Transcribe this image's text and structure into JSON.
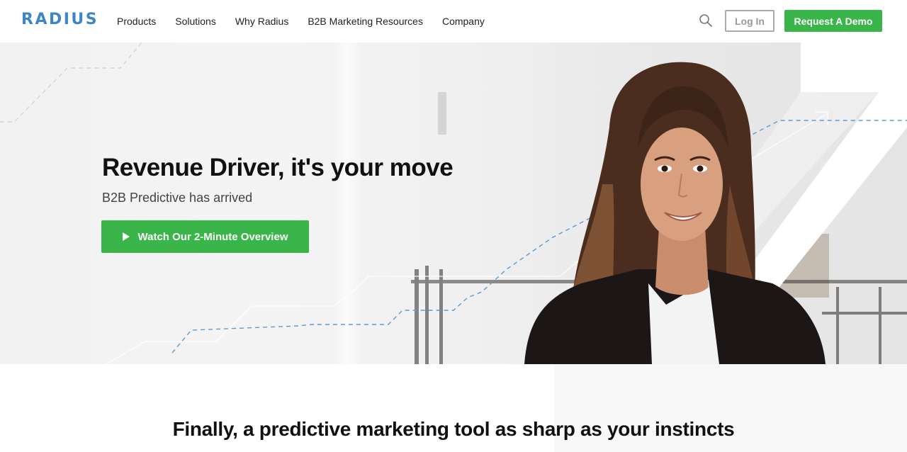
{
  "header": {
    "logo": "RADIUS",
    "nav": [
      {
        "label": "Products"
      },
      {
        "label": "Solutions"
      },
      {
        "label": "Why Radius"
      },
      {
        "label": "B2B Marketing Resources"
      },
      {
        "label": "Company"
      }
    ],
    "search_icon": "search-icon",
    "login_label": "Log In",
    "demo_label": "Request A Demo"
  },
  "hero": {
    "title": "Revenue Driver, it's your move",
    "subtitle": "B2B Predictive has arrived",
    "cta_label": "Watch Our 2-Minute Overview",
    "cta_icon": "play-icon",
    "image_alt": "Smiling woman in dark blazer"
  },
  "section": {
    "title": "Finally, a predictive marketing tool as sharp as your instincts"
  },
  "colors": {
    "brand_blue": "#3c86c6",
    "accent_green": "#39b54a",
    "dashed_line_blue": "#5b9bd5"
  }
}
